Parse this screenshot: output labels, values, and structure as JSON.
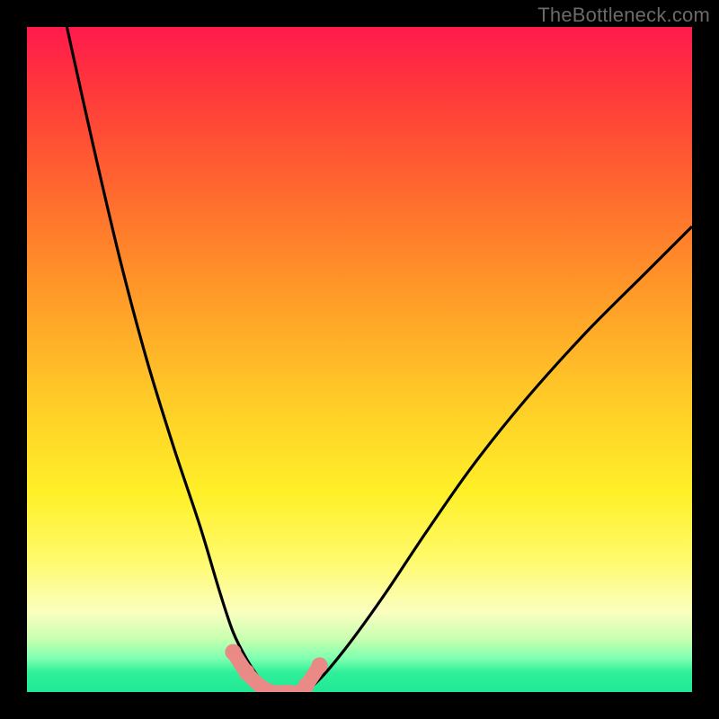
{
  "watermark": "TheBottleneck.com",
  "chart_data": {
    "type": "line",
    "title": "",
    "xlabel": "",
    "ylabel": "",
    "xlim": [
      0,
      100
    ],
    "ylim": [
      0,
      100
    ],
    "series": [
      {
        "name": "left-curve",
        "x": [
          6,
          10,
          14,
          18,
          22,
          26,
          29,
          31,
          33,
          35,
          37
        ],
        "values": [
          100,
          82,
          65,
          50,
          37,
          25,
          15,
          9,
          5,
          2,
          0
        ]
      },
      {
        "name": "right-curve",
        "x": [
          42,
          45,
          49,
          54,
          60,
          67,
          75,
          84,
          93,
          100
        ],
        "values": [
          0,
          3,
          8,
          15,
          24,
          34,
          44,
          54,
          63,
          70
        ]
      },
      {
        "name": "floor-highlight",
        "x": [
          31,
          33,
          35,
          37,
          39,
          41,
          42,
          44
        ],
        "values": [
          6,
          3,
          1,
          0,
          0,
          0,
          1,
          4
        ]
      }
    ],
    "colors": {
      "curve": "#000000",
      "highlight": "#e98a86"
    }
  }
}
